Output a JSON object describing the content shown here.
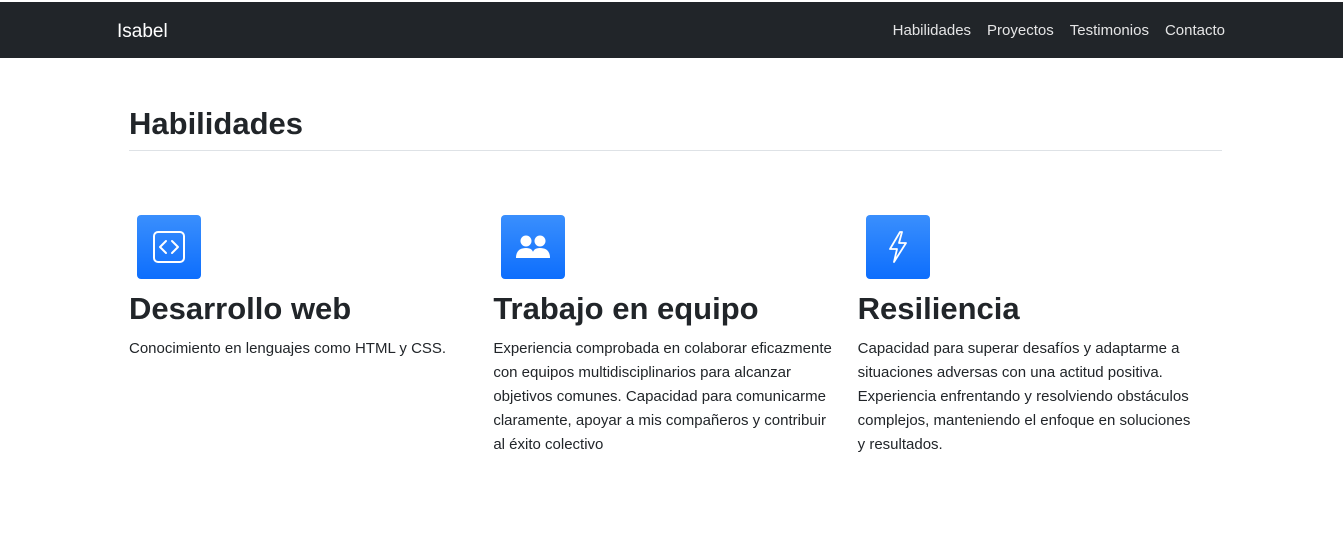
{
  "navbar": {
    "brand": "Isabel",
    "links": [
      "Habilidades",
      "Proyectos",
      "Testimonios",
      "Contacto"
    ],
    "background": "#212529"
  },
  "section": {
    "title": "Habilidades"
  },
  "features": [
    {
      "icon": "code-square-icon",
      "title": "Desarrollo web",
      "text": "Conocimiento en lenguajes como HTML y CSS."
    },
    {
      "icon": "people-icon",
      "title": "Trabajo en equipo",
      "text": "Experiencia comprobada en colaborar eficazmente con equipos multidisciplinarios para alcanzar objetivos comunes. Capacidad para comunicarme claramente, apoyar a mis compañeros y contribuir al éxito colectivo"
    },
    {
      "icon": "lightning-icon",
      "title": "Resiliencia",
      "text": "Capacidad para superar desafíos y adaptarme a situaciones adversas con una actitud positiva. Experiencia enfrentando y resolviendo obstáculos complejos, manteniendo el enfoque en soluciones y resultados."
    }
  ],
  "colors": {
    "accent": "#0d6efd",
    "text": "#212529",
    "divider": "#dee2e6"
  }
}
